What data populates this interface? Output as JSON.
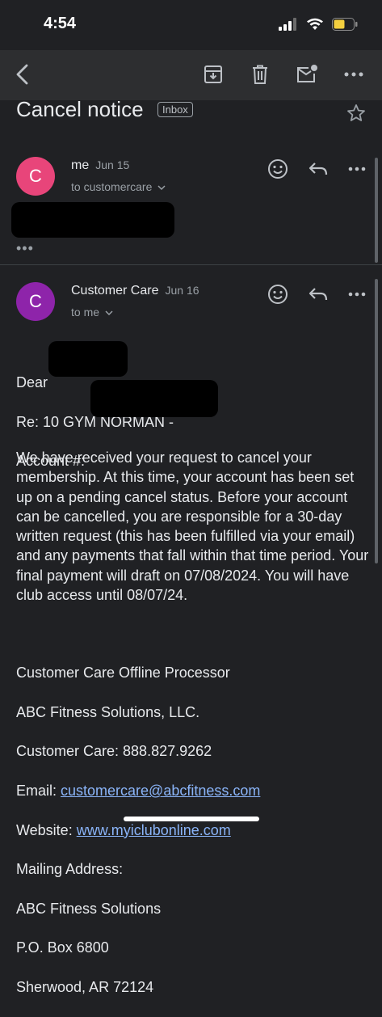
{
  "status_bar": {
    "time": "4:54"
  },
  "email": {
    "subject": "Cancel notice",
    "label": "Inbox",
    "messages": [
      {
        "avatar_letter": "C",
        "avatar_color": "#e8457a",
        "sender": "me",
        "date": "Jun 15",
        "recipient": "to customercare"
      },
      {
        "avatar_letter": "C",
        "avatar_color": "#8e24aa",
        "sender": "Customer Care",
        "date": "Jun 16",
        "recipient": "to me"
      }
    ],
    "collapsed_indicator": "•••",
    "body": {
      "greeting": "Dear",
      "re_line": "Re: 10 GYM NORMAN -",
      "account_line": "Account #:",
      "paragraph": "We have received your request to cancel your membership. At this time, your account has been set up on a pending cancel status. Before your account can be cancelled, you are responsible for a 30-day written request (this has been fulfilled via your email) and any payments that fall within that time period. Your final payment will draft on 07/08/2024. You will have club access until 08/07/24.",
      "sig_name": "Customer Care Offline Processor",
      "sig_company": "ABC Fitness Solutions, LLC.",
      "sig_phone": "Customer Care: 888.827.9262",
      "email_label": "Email: ",
      "email_link": "customercare@abcfitness.com",
      "website_label": "Website: ",
      "website_link": "www.myiclubonline.com",
      "mailing_label": "Mailing Address:",
      "addr1": "ABC Fitness Solutions",
      "addr2": "P.O. Box 6800",
      "addr3": "Sherwood, AR 72124"
    }
  },
  "icons": [
    "back-icon",
    "archive-icon",
    "delete-icon",
    "mark-unread-icon",
    "more-icon",
    "star-icon",
    "emoji-icon",
    "reply-icon",
    "chevron-down-icon"
  ],
  "colors": {
    "background": "#202124",
    "toolbar": "#2d2e30",
    "link": "#8ab4f8",
    "battery": "#f4d03f"
  }
}
